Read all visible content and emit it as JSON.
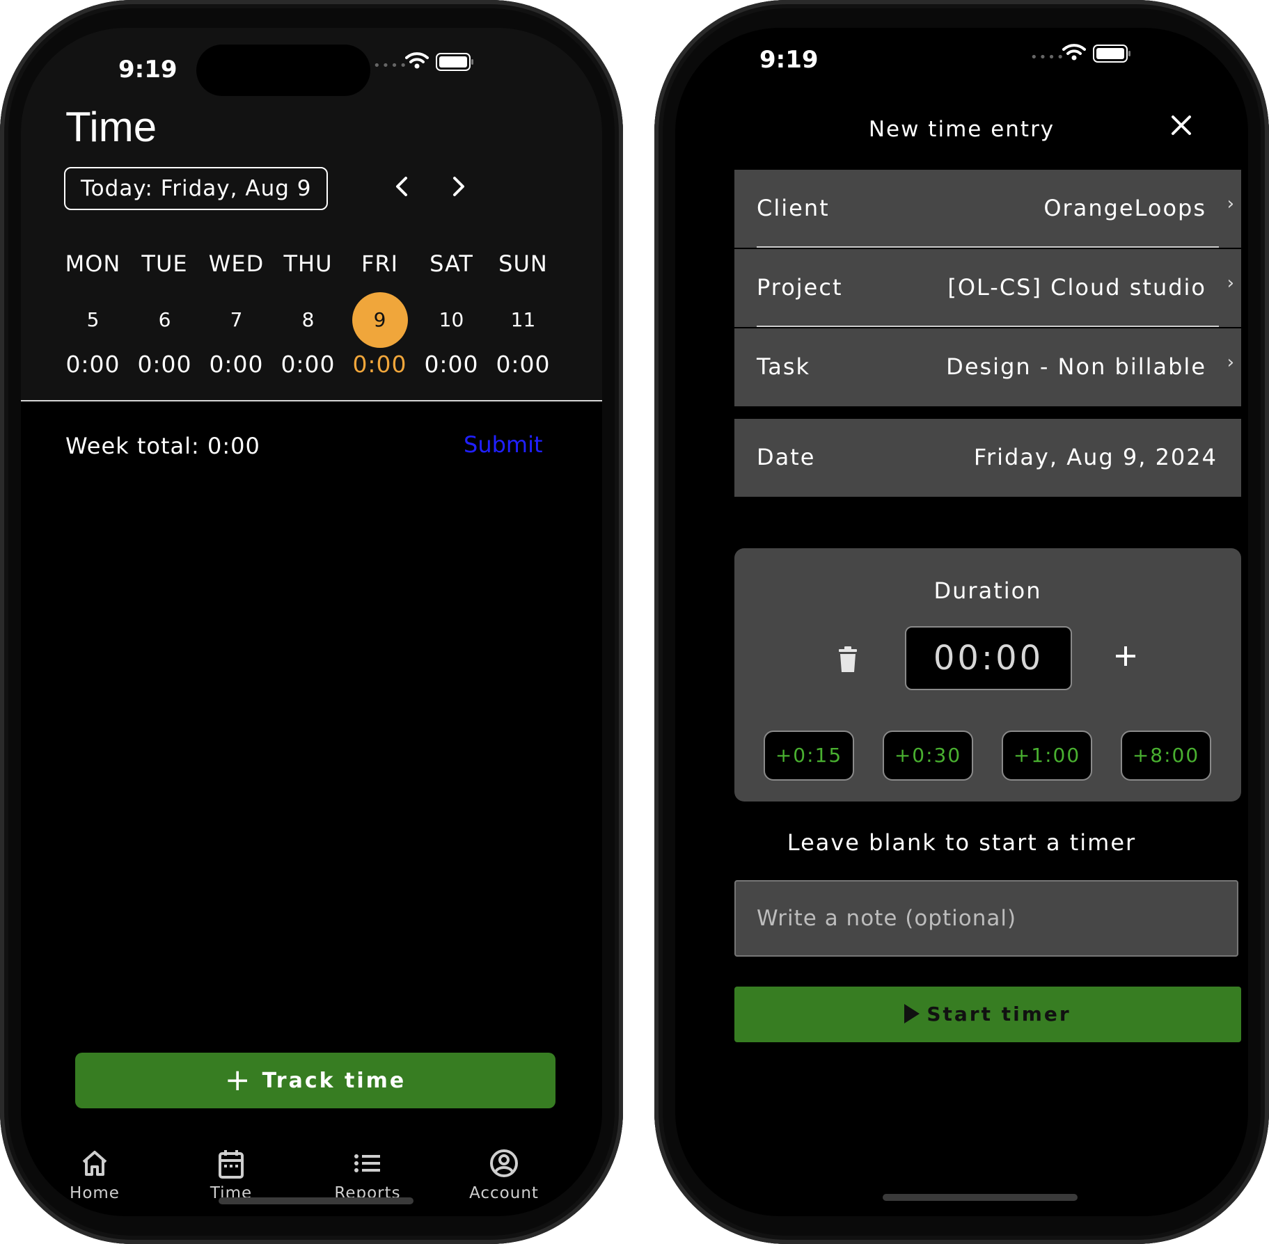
{
  "left": {
    "status_time": "9:19",
    "title": "Time",
    "today_label": "Today: Friday, Aug 9",
    "prev_icon": "chevron-left-icon",
    "next_icon": "chevron-right-icon",
    "days": [
      {
        "name": "MON",
        "num": "5",
        "hours": "0:00"
      },
      {
        "name": "TUE",
        "num": "6",
        "hours": "0:00"
      },
      {
        "name": "WED",
        "num": "7",
        "hours": "0:00"
      },
      {
        "name": "THU",
        "num": "8",
        "hours": "0:00"
      },
      {
        "name": "FRI",
        "num": "9",
        "hours": "0:00"
      },
      {
        "name": "SAT",
        "num": "10",
        "hours": "0:00"
      },
      {
        "name": "SUN",
        "num": "11",
        "hours": "0:00"
      }
    ],
    "selected_day_index": 4,
    "week_total": "Week total: 0:00",
    "submit_label": "Submit",
    "track_button": "Track time",
    "tabs": [
      {
        "label": "Home",
        "icon": "home-icon"
      },
      {
        "label": "Time",
        "icon": "calendar-icon"
      },
      {
        "label": "Reports",
        "icon": "list-icon"
      },
      {
        "label": "Account",
        "icon": "account-icon"
      }
    ]
  },
  "right": {
    "status_time": "9:19",
    "title": "New time entry",
    "close_icon": "close-icon",
    "fields": {
      "client": {
        "label": "Client",
        "value": "OrangeLoops"
      },
      "project": {
        "label": "Project",
        "value": "[OL-CS] Cloud studio"
      },
      "task": {
        "label": "Task",
        "value": "Design - Non billable"
      },
      "date": {
        "label": "Date",
        "value": "Friday, Aug 9, 2024"
      }
    },
    "duration": {
      "title": "Duration",
      "value": "00:00",
      "quick_adds": [
        "+0:15",
        "+0:30",
        "+1:00",
        "+8:00"
      ]
    },
    "hint": "Leave blank to start a timer",
    "note_placeholder": "Write a note (optional)",
    "start_button": "Start timer"
  },
  "colors": {
    "accent_orange": "#f0a63b",
    "primary_green": "#377d22",
    "chip_green": "#49b030",
    "link_blue": "#2020ff",
    "card_gray": "#474747"
  }
}
